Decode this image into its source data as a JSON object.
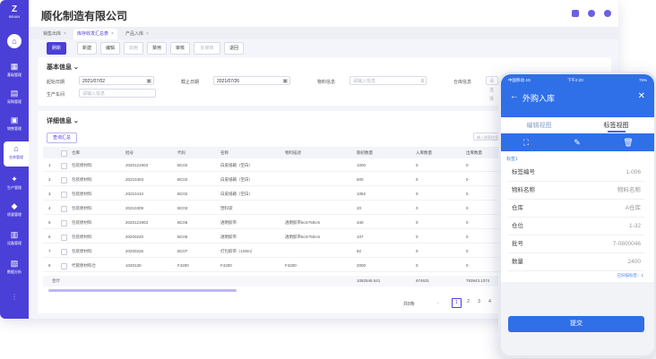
{
  "app": {
    "company": "顺化制造有限公司",
    "logo_text": "Z",
    "logo_sub": "BRAIN"
  },
  "sidebar": {
    "items": [
      {
        "icon": "home-icon",
        "label": ""
      },
      {
        "icon": "grid-icon",
        "label": "基础管理"
      },
      {
        "icon": "doc-icon",
        "label": "采购管理"
      },
      {
        "icon": "box-icon",
        "label": "销售管理"
      },
      {
        "icon": "warehouse-icon",
        "label": "仓库管理"
      },
      {
        "icon": "wrench-icon",
        "label": "生产管理"
      },
      {
        "icon": "shield-icon",
        "label": "质量管理"
      },
      {
        "icon": "server-icon",
        "label": "设备管理"
      },
      {
        "icon": "report-icon",
        "label": "数据分析"
      },
      {
        "icon": "settings-icon",
        "label": ""
      }
    ]
  },
  "tabs": [
    {
      "label": "销售出库"
    },
    {
      "label": "库存收发汇总表"
    },
    {
      "label": "产品入库"
    }
  ],
  "toolbar": {
    "buttons": [
      "刷新",
      "新建",
      "编辑",
      "启用",
      "禁用",
      "审核",
      "反审核",
      "退回"
    ]
  },
  "basic_info": {
    "title": "基本信息",
    "fields": {
      "start_date": {
        "label": "起始日期",
        "value": "2021/07/02"
      },
      "end_date": {
        "label": "截止日期",
        "value": "2021/07/26"
      },
      "material": {
        "label": "物料信息",
        "placeholder": "请输入信息"
      },
      "warehouse": {
        "label": "仓库信息",
        "placeholder": "请选择"
      },
      "producer": {
        "label": "生产车间",
        "placeholder": "请输入信息"
      }
    }
  },
  "detail": {
    "title": "详细信息",
    "summary_button": "查询汇总",
    "search_placeholder": "输入搜索信息",
    "columns": [
      "仓库",
      "批号",
      "代码",
      "名称",
      "物料描述",
      "期初数量",
      "入库数量",
      "出库数量"
    ],
    "rows": [
      [
        "包装原材料",
        "2020121903",
        "BC02",
        "白皮纸箱（空白）",
        "",
        "1000",
        "0",
        "0"
      ],
      [
        "包装原材料",
        "20210403",
        "BC02",
        "白皮纸箱（空白）",
        "",
        "600",
        "0",
        "0"
      ],
      [
        "包装原材料",
        "20210410",
        "BC02",
        "白皮纸箱（空白）",
        "",
        "1082",
        "0",
        "0"
      ],
      [
        "包装原材料",
        "20210309",
        "BC03",
        "塑料袋",
        "",
        "20",
        "0",
        "0"
      ],
      [
        "包装原材料",
        "2020121903",
        "BC05",
        "透明胶带",
        "透明胶带6cm*50cm",
        "340",
        "0",
        "0"
      ],
      [
        "包装原材料",
        "20200220",
        "BC05",
        "透明胶带",
        "透明胶带6cm*50cm",
        "107",
        "0",
        "0"
      ],
      [
        "包装原材料",
        "20200226",
        "BC07",
        "打包胶带（100m）",
        "",
        "92",
        "0",
        "0"
      ],
      [
        "代管原材料仓",
        "1020130",
        "F4200",
        "F4200",
        "F4200",
        "2000",
        "0",
        "0"
      ]
    ],
    "total_label": "合计",
    "totals": [
      "1082546.541",
      "674631",
      "793943.1374"
    ]
  },
  "pager": {
    "total_label": "共8条",
    "pages": [
      "1",
      "2",
      "3",
      "4"
    ],
    "current": "1"
  },
  "phone": {
    "status_left": "中国移动 4G",
    "status_time": "下午2:20",
    "status_right": "75%",
    "title": "外购入库",
    "tabs": [
      "编辑视图",
      "标签视图"
    ],
    "active_tab": 1,
    "tag": "标签1",
    "fields": [
      {
        "k": "标签编号",
        "v": "1-006"
      },
      {
        "k": "物料名称",
        "v": "物料名称"
      },
      {
        "k": "仓库",
        "v": "A仓库"
      },
      {
        "k": "仓位",
        "v": "1-32"
      },
      {
        "k": "批号",
        "v": "7-0800046"
      },
      {
        "k": "数量",
        "v": "2400"
      }
    ],
    "link": "已扫描标签：1",
    "submit": "提交"
  },
  "colors": {
    "sidebar": "#4a3fd6",
    "phone_accent": "#2f6fe8"
  }
}
